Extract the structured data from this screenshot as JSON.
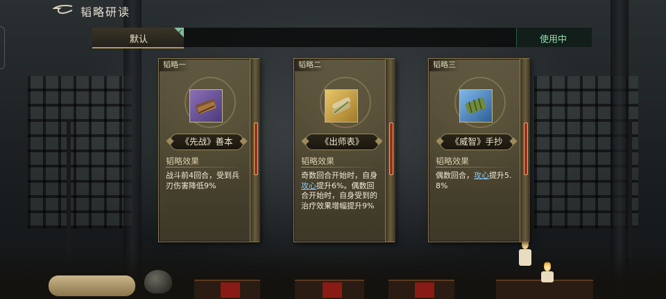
{
  "header": {
    "title": "韬略研读"
  },
  "tabbar": {
    "default_tab": "默认",
    "status": "使用中"
  },
  "cards": [
    {
      "tag": "韬略一",
      "name": "《先战》善本",
      "effect_label": "韬略效果",
      "desc_before": "战斗前4回合，受到兵刃伤害降低9%",
      "highlight": "",
      "desc_after": "",
      "icon": "book-bundle-icon"
    },
    {
      "tag": "韬略二",
      "name": "《出师表》",
      "effect_label": "韬略效果",
      "desc_before": "奇数回合开始时，自身",
      "highlight": "攻心",
      "desc_after": "提升6%。偶数回合开始时，自身受到的治疗效果增幅提升9%",
      "icon": "scroll-icon"
    },
    {
      "tag": "韬略三",
      "name": "《威智》手抄",
      "effect_label": "韬略效果",
      "desc_before": "偶数回合，",
      "highlight": "攻心",
      "desc_after": "提升5.8%",
      "icon": "bamboo-slips-icon"
    }
  ],
  "colors": {
    "accent_gold": "#b79a52",
    "status_green": "#8fe0b0",
    "highlight_blue": "#8ccfff"
  }
}
